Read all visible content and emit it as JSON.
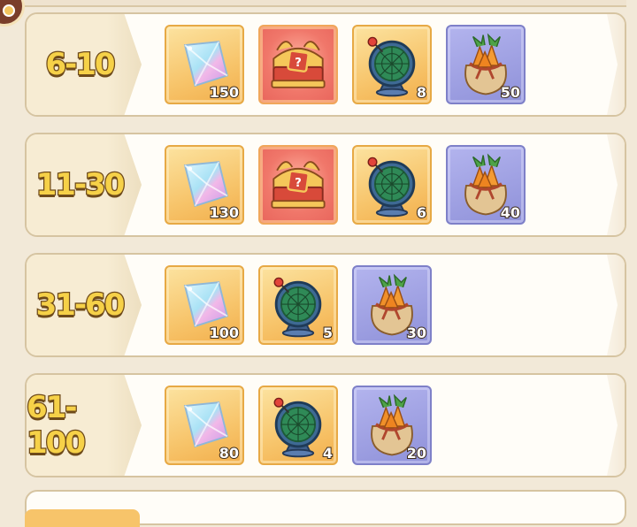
{
  "ranks": [
    {
      "label": "6-10",
      "items": [
        {
          "type": "crystal",
          "count": "150"
        },
        {
          "type": "chest",
          "count": ""
        },
        {
          "type": "compass",
          "count": "8"
        },
        {
          "type": "carrot-sack",
          "count": "50"
        }
      ]
    },
    {
      "label": "11-30",
      "items": [
        {
          "type": "crystal",
          "count": "130"
        },
        {
          "type": "chest",
          "count": ""
        },
        {
          "type": "compass",
          "count": "6"
        },
        {
          "type": "carrot-sack",
          "count": "40"
        }
      ]
    },
    {
      "label": "31-60",
      "items": [
        {
          "type": "crystal",
          "count": "100"
        },
        {
          "type": "compass",
          "count": "5"
        },
        {
          "type": "carrot-sack",
          "count": "30"
        }
      ]
    },
    {
      "label": "61-100",
      "items": [
        {
          "type": "crystal",
          "count": "80"
        },
        {
          "type": "compass",
          "count": "4"
        },
        {
          "type": "carrot-sack",
          "count": "20"
        }
      ]
    }
  ],
  "colors": {
    "rank_fill": "#f6d148",
    "rank_outline": "#6e4a1a",
    "gold_slot": "#f7c46a",
    "red_slot": "#f0776a",
    "purple_slot": "#8f91d9"
  }
}
